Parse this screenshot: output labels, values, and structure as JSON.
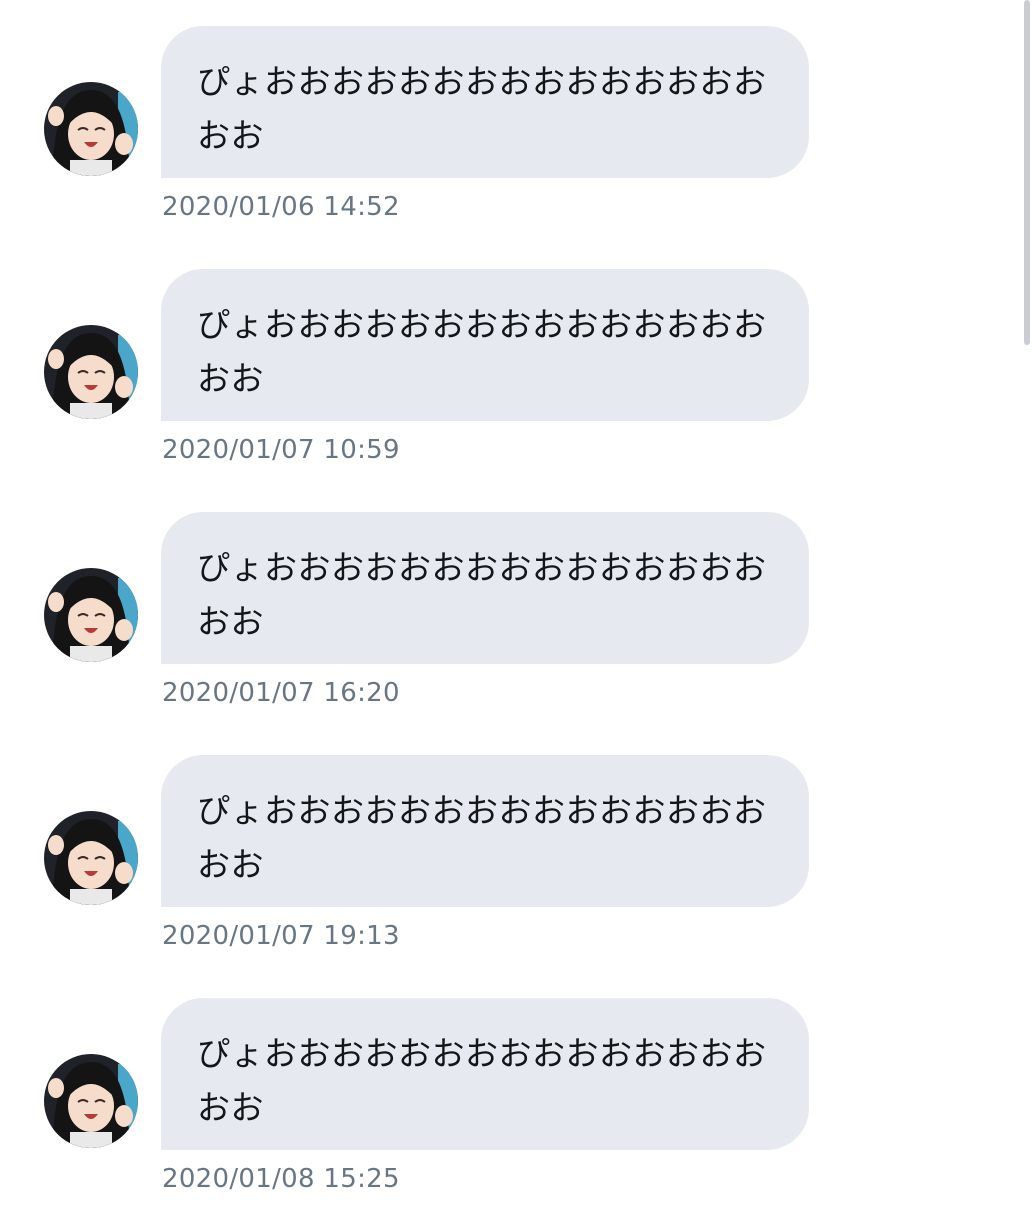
{
  "messages": [
    {
      "text": "ぴょおおおおおおおおおおおおおおおおお",
      "timestamp": "2020/01/06 14:52"
    },
    {
      "text": "ぴょおおおおおおおおおおおおおおおおお",
      "timestamp": "2020/01/07 10:59"
    },
    {
      "text": "ぴょおおおおおおおおおおおおおおおおお",
      "timestamp": "2020/01/07 16:20"
    },
    {
      "text": "ぴょおおおおおおおおおおおおおおおおお",
      "timestamp": "2020/01/07 19:13"
    },
    {
      "text": "ぴょおおおおおおおおおおおおおおおおお",
      "timestamp": "2020/01/08 15:25"
    }
  ],
  "colors": {
    "bubble_bg": "#e7e9f0",
    "text": "#14171a",
    "timestamp": "#687684"
  }
}
